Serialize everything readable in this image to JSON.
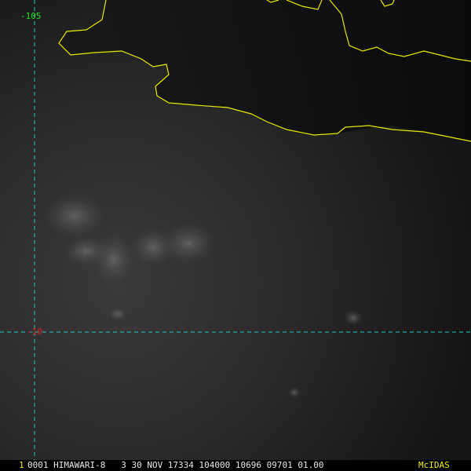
{
  "map": {
    "colors": {
      "coastline": "#e8e800",
      "graticule": "#20c8c8",
      "lon_label": "#20e020",
      "lat_label": "#e02020",
      "status_white": "#e8e8e8",
      "brand": "#f0f000"
    },
    "graticule": {
      "longitude_label": "-105",
      "latitude_label": "-10"
    }
  },
  "status_bar": {
    "frame": "1",
    "text": "0001 HIMAWARI-8   3 30 NOV 17334 104000 10696 09701 01.00",
    "brand": "McIDAS"
  }
}
